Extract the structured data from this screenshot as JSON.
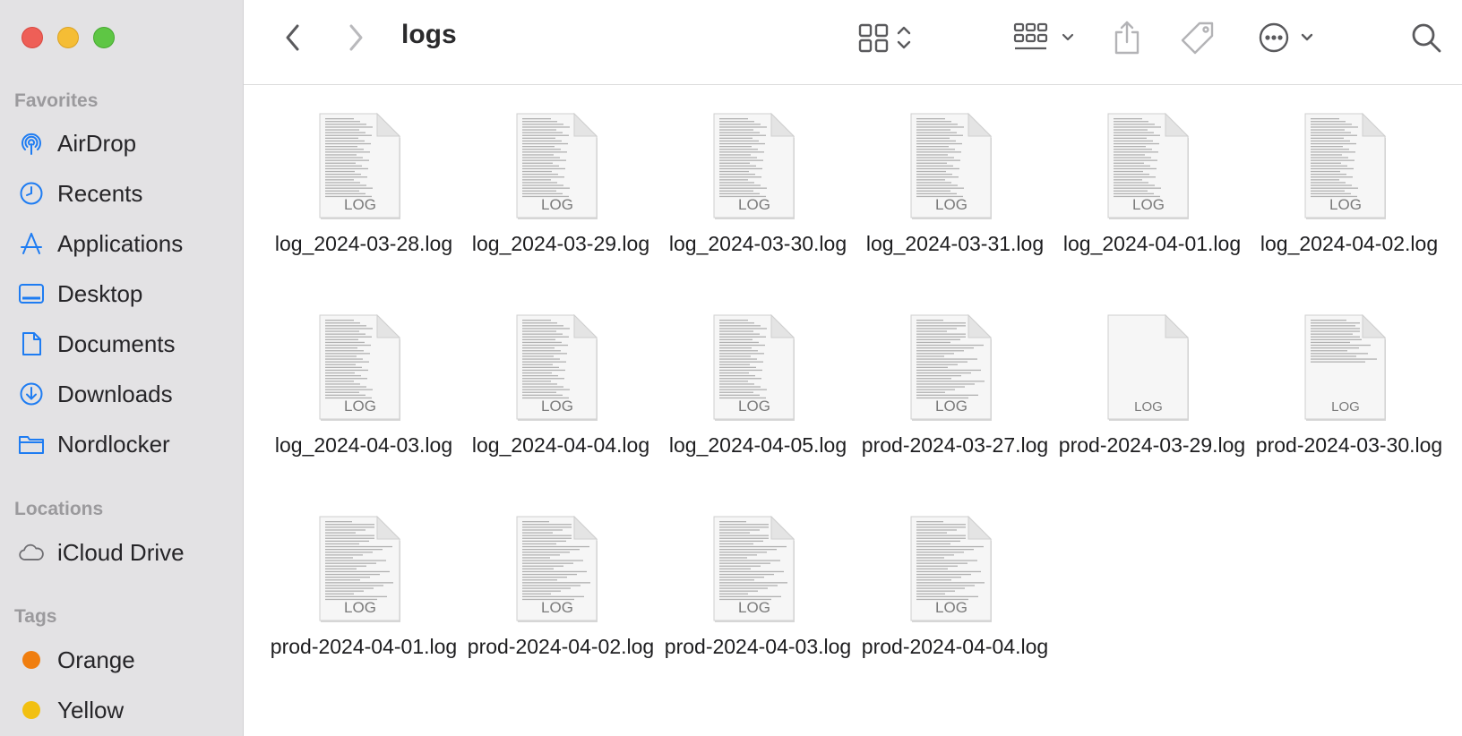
{
  "window": {
    "title": "logs"
  },
  "sidebar": {
    "favorites_title": "Favorites",
    "favorites": [
      {
        "label": "AirDrop",
        "icon": "airdrop-icon"
      },
      {
        "label": "Recents",
        "icon": "clock-icon"
      },
      {
        "label": "Applications",
        "icon": "applications-icon"
      },
      {
        "label": "Desktop",
        "icon": "desktop-icon"
      },
      {
        "label": "Documents",
        "icon": "document-icon"
      },
      {
        "label": "Downloads",
        "icon": "download-icon"
      },
      {
        "label": "Nordlocker",
        "icon": "folder-icon"
      }
    ],
    "locations_title": "Locations",
    "locations": [
      {
        "label": "iCloud Drive",
        "icon": "cloud-icon"
      }
    ],
    "tags_title": "Tags",
    "tags": [
      {
        "label": "Orange",
        "color": "#f07e0f"
      },
      {
        "label": "Yellow",
        "color": "#f2c011"
      }
    ]
  },
  "toolbar": {
    "back_icon": "chevron-left-icon",
    "forward_icon": "chevron-right-icon",
    "view_icon": "grid-view-icon",
    "group_icon": "group-icon",
    "share_icon": "share-icon",
    "tag_icon": "tag-icon",
    "more_icon": "ellipsis-icon",
    "search_icon": "search-icon"
  },
  "files": [
    {
      "name": "log_2024-03-28.log",
      "badge": "LOG",
      "density": "dense"
    },
    {
      "name": "log_2024-03-29.log",
      "badge": "LOG",
      "density": "dense"
    },
    {
      "name": "log_2024-03-30.log",
      "badge": "LOG",
      "density": "dense"
    },
    {
      "name": "log_2024-03-31.log",
      "badge": "LOG",
      "density": "dense"
    },
    {
      "name": "log_2024-04-01.log",
      "badge": "LOG",
      "density": "dense"
    },
    {
      "name": "log_2024-04-02.log",
      "badge": "LOG",
      "density": "dense"
    },
    {
      "name": "log_2024-04-03.log",
      "badge": "LOG",
      "density": "dense"
    },
    {
      "name": "log_2024-04-04.log",
      "badge": "LOG",
      "density": "dense"
    },
    {
      "name": "log_2024-04-05.log",
      "badge": "LOG",
      "density": "dense"
    },
    {
      "name": "prod-2024-03-27.log",
      "badge": "LOG",
      "density": "wide"
    },
    {
      "name": "prod-2024-03-29.log",
      "badge": "LOG",
      "density": "blank"
    },
    {
      "name": "prod-2024-03-30.log",
      "badge": "LOG",
      "density": "short"
    },
    {
      "name": "prod-2024-04-01.log",
      "badge": "LOG",
      "density": "wide"
    },
    {
      "name": "prod-2024-04-02.log",
      "badge": "LOG",
      "density": "wide"
    },
    {
      "name": "prod-2024-04-03.log",
      "badge": "LOG",
      "density": "wide"
    },
    {
      "name": "prod-2024-04-04.log",
      "badge": "LOG",
      "density": "wide"
    }
  ]
}
